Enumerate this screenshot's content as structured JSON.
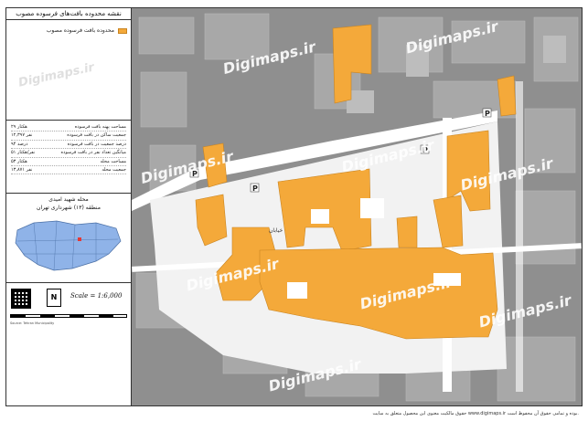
{
  "sidebar": {
    "title": "نقشه محدوده بافت‌های فرسوده مصوب",
    "legend_label": "محدوده بافت فرسوده مصوب",
    "stats": [
      {
        "label": "مساحت پهنه بافت فرسوده",
        "value": "۲۹ هکتار"
      },
      {
        "label": "جمعیت ساکن در بافت فرسوده",
        "value": "۱۲,۳۹۷ نفر"
      },
      {
        "label": "درصد جمعیت در بافت فرسوده",
        "value": "۹۴ درصد"
      },
      {
        "label": "میانگین تعداد نفر در بافت فرسوده",
        "value": "۵۱ نفر/هکتار"
      },
      {
        "label": "مساحت محله",
        "value": "۵۳ هکتار"
      },
      {
        "label": "جمعیت محله",
        "value": "۱۳,۸۷۱ نفر"
      }
    ],
    "locator_title": "محله شهید امیدی",
    "locator_subtitle": "منطقه (۱۳) شهرداری تهران",
    "north_label": "N",
    "scale_label": "Scale = 1:6,000",
    "credit": "Source: Tehran Municipality"
  },
  "map": {
    "watermark": "Digimaps.ir",
    "parking_symbol": "P",
    "street_label": "خیابان"
  },
  "footer": "حقوق مالکیت معنوی این محصول متعلق به سایت www.digimaps.ir بوده و تمامی حقوق آن محفوظ است.",
  "colors": {
    "deteriorated": "#f4a93a",
    "built": "#a9a9a9",
    "road": "#ffffff",
    "map_bg": "#8e8e8e"
  }
}
